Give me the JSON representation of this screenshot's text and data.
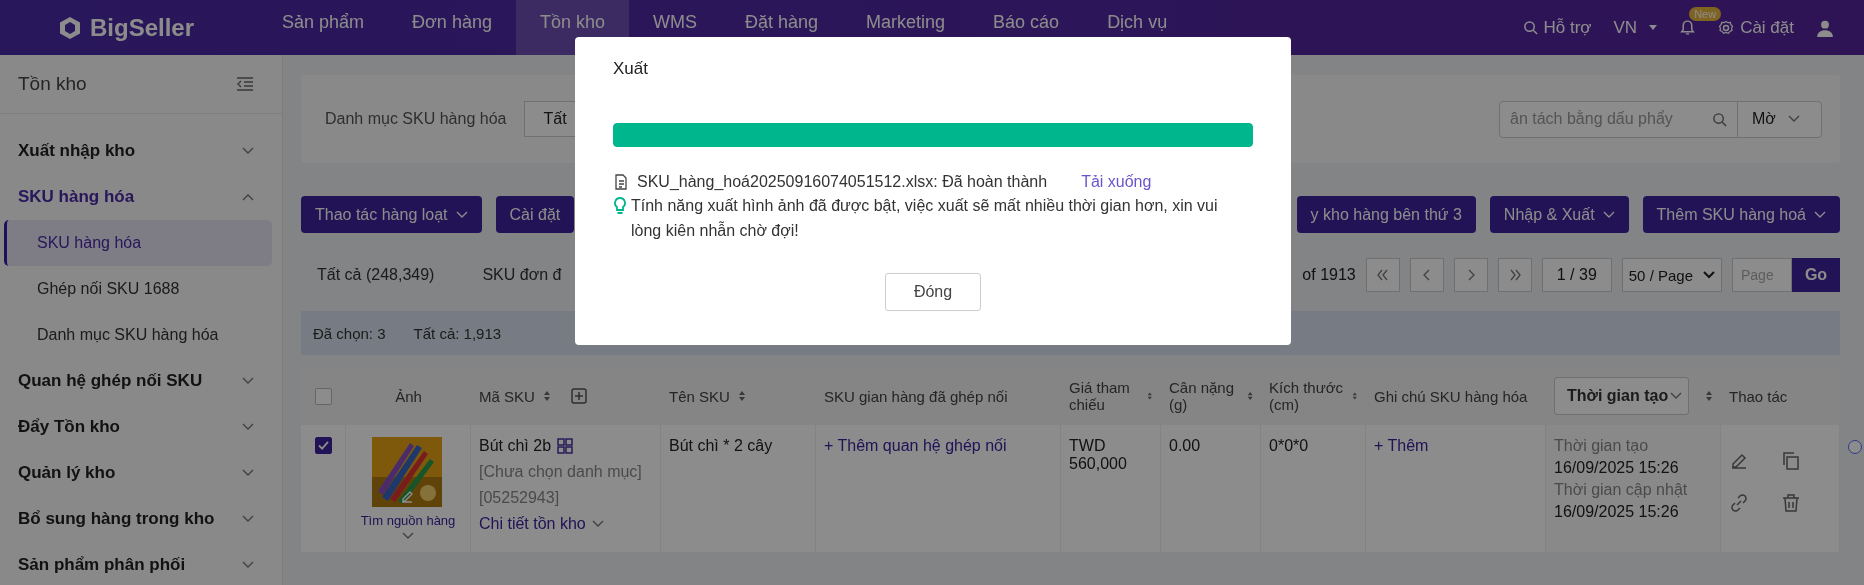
{
  "topbar": {
    "logo": "BigSeller",
    "menu": [
      {
        "label": "Sản phẩm",
        "selected": false
      },
      {
        "label": "Đơn hàng",
        "selected": false
      },
      {
        "label": "Tồn kho",
        "selected": true
      },
      {
        "label": "WMS",
        "selected": false
      },
      {
        "label": "Đặt hàng",
        "selected": false
      },
      {
        "label": "Marketing",
        "selected": false
      },
      {
        "label": "Báo cáo",
        "selected": false
      },
      {
        "label": "Dịch vụ",
        "selected": false
      }
    ],
    "help": "Hỗ trợ",
    "language": "VN",
    "notification_badge": "New",
    "settings": "Cài đặt"
  },
  "sidebar": {
    "title": "Tồn kho",
    "items": [
      {
        "label": "Xuất nhập kho",
        "expanded": false
      },
      {
        "label": "SKU hàng hóa",
        "expanded": true,
        "children": [
          {
            "label": "SKU hàng hóa",
            "selected": true
          },
          {
            "label": "Ghép nối SKU 1688",
            "selected": false
          },
          {
            "label": "Danh mục SKU hàng hóa",
            "selected": false
          }
        ]
      },
      {
        "label": "Quan hệ ghép nối SKU",
        "expanded": false
      },
      {
        "label": "Đẩy Tồn kho",
        "expanded": false
      },
      {
        "label": "Quản lý kho",
        "expanded": false
      },
      {
        "label": "Bổ sung hàng trong kho",
        "expanded": false
      },
      {
        "label": "Sản phẩm phân phối",
        "expanded": false
      }
    ]
  },
  "filter": {
    "label": "Danh mục SKU hàng hóa",
    "category_value": "Tất",
    "search_placeholder": "ân tách bằng dấu phẩy",
    "match_mode": "Mờ"
  },
  "toolbar": {
    "left": [
      {
        "label": "Thao tác hàng loạt",
        "dropdown": true
      },
      {
        "label": "Cài đặt",
        "dropdown": false
      }
    ],
    "right": [
      {
        "label": "y kho hàng bên thứ 3",
        "dropdown": false
      },
      {
        "label": "Nhập & Xuất",
        "dropdown": true
      },
      {
        "label": "Thêm SKU hàng hoá",
        "dropdown": true
      }
    ]
  },
  "tabs": [
    {
      "label": "Tất cả (248,349)",
      "selected": false
    },
    {
      "label": "SKU đơn đ",
      "selected": false
    }
  ],
  "pagination": {
    "total": "of 1913",
    "page": "1 / 39",
    "page_size": "50 / Page",
    "page_placeholder": "Page",
    "go": "Go"
  },
  "selection": {
    "selected": "Đã chọn: 3",
    "total": "Tất cả: 1,913"
  },
  "table": {
    "columns": [
      {
        "kind": "checkbox",
        "checked": false
      },
      {
        "kind": "plain",
        "label": "Ảnh"
      },
      {
        "kind": "sortable_addable",
        "label": "Mã SKU"
      },
      {
        "kind": "sortable",
        "label": "Tên SKU"
      },
      {
        "kind": "plain",
        "label": "SKU gian hàng đã ghép nối"
      },
      {
        "kind": "sortable",
        "label": "Giá tham chiếu"
      },
      {
        "kind": "sortable",
        "label": "Cân nặng (g)"
      },
      {
        "kind": "sortable",
        "label": "Kích thước (cm)"
      },
      {
        "kind": "plain",
        "label": "Ghi chú SKU hàng hóa"
      },
      {
        "kind": "select",
        "label": "Thời gian tạo"
      },
      {
        "kind": "plain",
        "label": "Thao tác"
      }
    ],
    "rows": [
      {
        "checked": true,
        "source_link": "Tìm nguồn hàng",
        "sku": "Bút chì 2b",
        "category": "[Chưa chọn danh mục]",
        "code": "[05252943]",
        "stock_link": "Chi tiết tồn kho",
        "name": "Bút chì * 2 cây",
        "linked": "+ Thêm quan hệ ghép nối",
        "price": "TWD 560,000",
        "weight": "0.00",
        "size": "0*0*0",
        "note": "+ Thêm",
        "created_label": "Thời gian tạo",
        "created": "16/09/2025 15:26",
        "updated_label": "Thời gian cập nhật",
        "updated": "16/09/2025 15:26"
      }
    ]
  },
  "dialog": {
    "title": "Xuất",
    "level": 1,
    "file": "SKU_hàng_hoá20250916074051512.xlsx: Đã hoàn thành",
    "download": "Tải xuống",
    "tip": "Tính năng xuất hình ảnh đã được bật, việc xuất sẽ mất nhiều thời gian hơn, xin vui lòng kiên nhẫn chờ đợi!",
    "close": "Đóng"
  }
}
